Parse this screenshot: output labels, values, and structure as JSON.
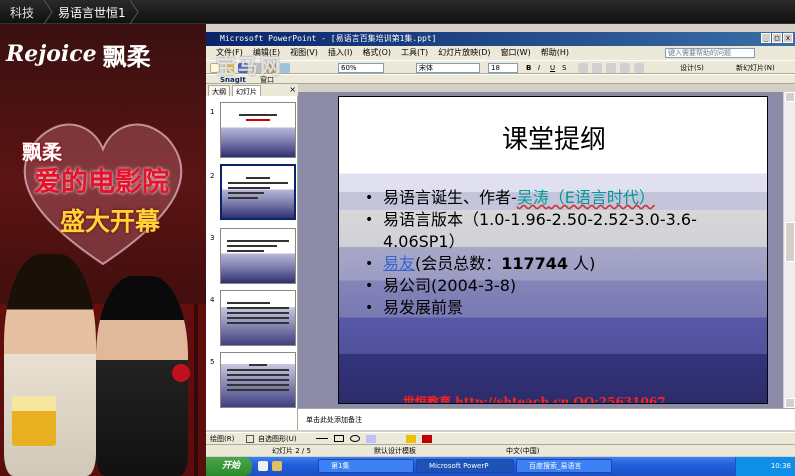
{
  "player": {
    "breadcrumb": [
      "科技",
      "易语言世恒1"
    ]
  },
  "ad": {
    "brand_en": "Rejoice",
    "brand_cn": "飘柔",
    "line1": "飘柔",
    "line2": "爱的电影院",
    "line3": "盛大开幕"
  },
  "ppt": {
    "window_title": "Microsoft PowerPoint - [易语言百集培训第1集.ppt]",
    "menu": [
      "文件(F)",
      "编辑(E)",
      "视图(V)",
      "插入(I)",
      "格式(O)",
      "工具(T)",
      "幻灯片放映(D)",
      "窗口(W)",
      "帮助(H)"
    ],
    "help_placeholder": "键入需要帮助的问题",
    "zoom": "60%",
    "font_name": "宋体",
    "font_size": "18",
    "design_label": "设计(S)",
    "new_slide_label": "新幻灯片(N)",
    "toolbar_watermark": "宝马网",
    "snagit_label": "SnagIt",
    "window_label": "窗口",
    "pane_tabs": [
      "大纲",
      "幻灯片"
    ],
    "thumb_numbers": [
      "1",
      "2",
      "3",
      "4",
      "5"
    ],
    "slide": {
      "title": "课堂提纲",
      "bullets": [
        {
          "before": "易语言诞生、作者-",
          "link": "吴涛",
          "after": "（E语言时代）"
        },
        {
          "text": "易语言版本（1.0-1.96-2.50-2.52-3.0-3.6-4.06SP1）"
        },
        {
          "link": "易友",
          "after": "(会员总数：",
          "bold": "117744",
          "tail": " 人)"
        },
        {
          "text": "易公司(2004-3-8)"
        },
        {
          "text": "易发展前景"
        }
      ],
      "watermark": "世恒教育 http://shteach.cn QQ:25631067"
    },
    "notes_placeholder": "单击此处添加备注",
    "draw_label": "绘图(R)",
    "autoshape_label": "自选图形(U)",
    "status": {
      "slide": "幻灯片 2 / 5",
      "template": "默认设计模板",
      "language": "中文(中国)"
    },
    "taskbar": {
      "start": "开始",
      "tasks": [
        "第1集",
        "Microsoft PowerP",
        "百度搜索_易语言"
      ],
      "clock": "10:36"
    }
  }
}
